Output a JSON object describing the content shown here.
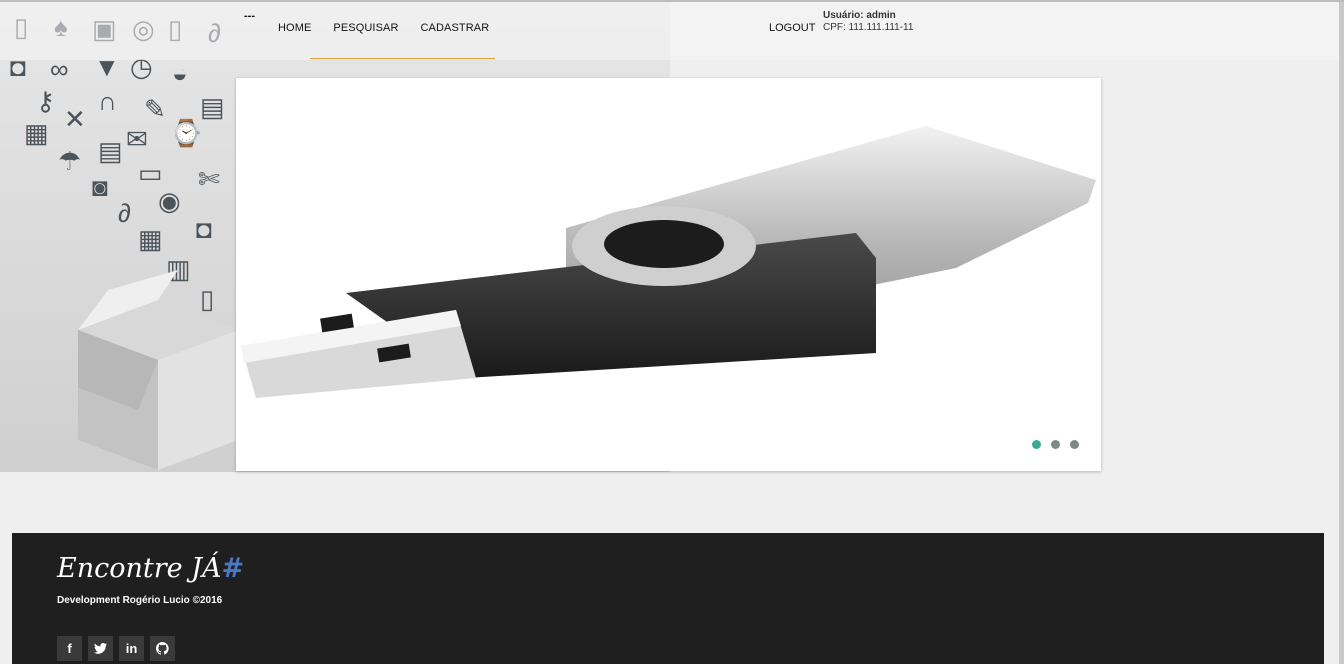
{
  "header": {
    "nav_separator": "---",
    "nav_items": [
      {
        "label": "HOME"
      },
      {
        "label": "PESQUISAR"
      },
      {
        "label": "CADASTRAR"
      }
    ],
    "logout_label": "LOGOUT",
    "user_line": "Usuário: admin",
    "cpf_line": "CPF: 111.111.111-11"
  },
  "slider": {
    "slide_count": 3,
    "active_index": 0,
    "image_subject": "usb-flash-drive",
    "accent_color": "#3aa99b",
    "inactive_dot_color": "#7b8a86"
  },
  "footer": {
    "brand_text": "Encontre JÁ",
    "brand_mark": "#",
    "credit": "Development Rogério Lucio ©2016",
    "social_icons": [
      {
        "name": "facebook-icon",
        "glyph": "f"
      },
      {
        "name": "twitter-icon",
        "glyph": "t"
      },
      {
        "name": "linkedin-icon",
        "glyph": "in"
      },
      {
        "name": "github-icon",
        "glyph": "gh"
      }
    ]
  },
  "colors": {
    "footer_bg": "#1f1f1f",
    "page_bg": "#efefef",
    "nav_underline": "#e6a23a",
    "brand_hash": "#4a78c9"
  }
}
